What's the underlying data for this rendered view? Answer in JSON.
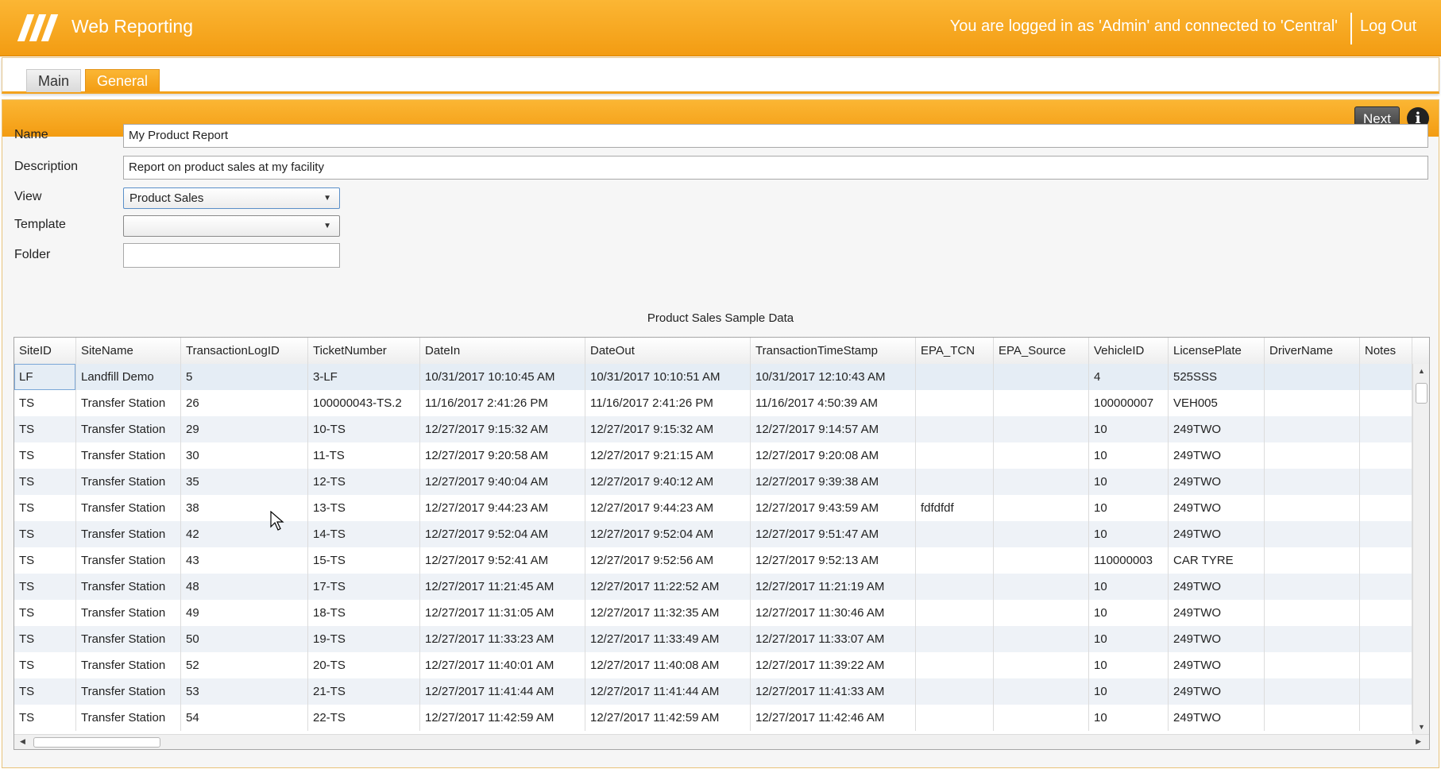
{
  "header": {
    "app_title": "Web Reporting",
    "login_status": "You are logged in as 'Admin' and connected to 'Central'",
    "logout_label": "Log Out",
    "brand_color": "#f39c12"
  },
  "tabs": [
    {
      "label": "Main",
      "active": false
    },
    {
      "label": "General",
      "active": true
    }
  ],
  "toolbar": {
    "next_label": "Next",
    "info_icon": "info-icon"
  },
  "form": {
    "name_label": "Name",
    "name_value": "My Product Report",
    "description_label": "Description",
    "description_value": "Report on product sales at my facility",
    "view_label": "View",
    "view_value": "Product Sales",
    "template_label": "Template",
    "template_value": "",
    "folder_label": "Folder",
    "folder_value": ""
  },
  "grid": {
    "title": "Product Sales Sample Data",
    "columns": [
      "SiteID",
      "SiteName",
      "TransactionLogID",
      "TicketNumber",
      "DateIn",
      "DateOut",
      "TransactionTimeStamp",
      "EPA_TCN",
      "EPA_Source",
      "VehicleID",
      "LicensePlate",
      "DriverName",
      "Notes"
    ],
    "rows": [
      [
        "LF",
        "Landfill Demo",
        "5",
        "3-LF",
        "10/31/2017 10:10:45 AM",
        "10/31/2017 10:10:51 AM",
        "10/31/2017 12:10:43 AM",
        "",
        "",
        "4",
        "525SSS",
        "",
        ""
      ],
      [
        "TS",
        "Transfer Station",
        "26",
        "100000043-TS.2",
        "11/16/2017 2:41:26 PM",
        "11/16/2017 2:41:26 PM",
        "11/16/2017 4:50:39 AM",
        "",
        "",
        "100000007",
        "VEH005",
        "",
        ""
      ],
      [
        "TS",
        "Transfer Station",
        "29",
        "10-TS",
        "12/27/2017 9:15:32 AM",
        "12/27/2017 9:15:32 AM",
        "12/27/2017 9:14:57 AM",
        "",
        "",
        "10",
        "249TWO",
        "",
        ""
      ],
      [
        "TS",
        "Transfer Station",
        "30",
        "11-TS",
        "12/27/2017 9:20:58 AM",
        "12/27/2017 9:21:15 AM",
        "12/27/2017 9:20:08 AM",
        "",
        "",
        "10",
        "249TWO",
        "",
        ""
      ],
      [
        "TS",
        "Transfer Station",
        "35",
        "12-TS",
        "12/27/2017 9:40:04 AM",
        "12/27/2017 9:40:12 AM",
        "12/27/2017 9:39:38 AM",
        "",
        "",
        "10",
        "249TWO",
        "",
        ""
      ],
      [
        "TS",
        "Transfer Station",
        "38",
        "13-TS",
        "12/27/2017 9:44:23 AM",
        "12/27/2017 9:44:23 AM",
        "12/27/2017 9:43:59 AM",
        "fdfdfdf",
        "",
        "10",
        "249TWO",
        "",
        ""
      ],
      [
        "TS",
        "Transfer Station",
        "42",
        "14-TS",
        "12/27/2017 9:52:04 AM",
        "12/27/2017 9:52:04 AM",
        "12/27/2017 9:51:47 AM",
        "",
        "",
        "10",
        "249TWO",
        "",
        ""
      ],
      [
        "TS",
        "Transfer Station",
        "43",
        "15-TS",
        "12/27/2017 9:52:41 AM",
        "12/27/2017 9:52:56 AM",
        "12/27/2017 9:52:13 AM",
        "",
        "",
        "110000003",
        "CAR TYRE",
        "",
        ""
      ],
      [
        "TS",
        "Transfer Station",
        "48",
        "17-TS",
        "12/27/2017 11:21:45 AM",
        "12/27/2017 11:22:52 AM",
        "12/27/2017 11:21:19 AM",
        "",
        "",
        "10",
        "249TWO",
        "",
        ""
      ],
      [
        "TS",
        "Transfer Station",
        "49",
        "18-TS",
        "12/27/2017 11:31:05 AM",
        "12/27/2017 11:32:35 AM",
        "12/27/2017 11:30:46 AM",
        "",
        "",
        "10",
        "249TWO",
        "",
        ""
      ],
      [
        "TS",
        "Transfer Station",
        "50",
        "19-TS",
        "12/27/2017 11:33:23 AM",
        "12/27/2017 11:33:49 AM",
        "12/27/2017 11:33:07 AM",
        "",
        "",
        "10",
        "249TWO",
        "",
        ""
      ],
      [
        "TS",
        "Transfer Station",
        "52",
        "20-TS",
        "12/27/2017 11:40:01 AM",
        "12/27/2017 11:40:08 AM",
        "12/27/2017 11:39:22 AM",
        "",
        "",
        "10",
        "249TWO",
        "",
        ""
      ],
      [
        "TS",
        "Transfer Station",
        "53",
        "21-TS",
        "12/27/2017 11:41:44 AM",
        "12/27/2017 11:41:44 AM",
        "12/27/2017 11:41:33 AM",
        "",
        "",
        "10",
        "249TWO",
        "",
        ""
      ],
      [
        "TS",
        "Transfer Station",
        "54",
        "22-TS",
        "12/27/2017 11:42:59 AM",
        "12/27/2017 11:42:59 AM",
        "12/27/2017 11:42:46 AM",
        "",
        "",
        "10",
        "249TWO",
        "",
        ""
      ]
    ]
  }
}
